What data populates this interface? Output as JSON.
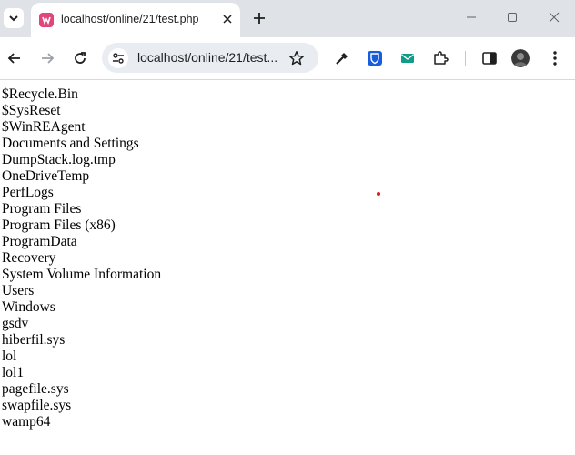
{
  "browser": {
    "tab": {
      "title": "localhost/online/21/test.php"
    },
    "address_bar": {
      "url": "localhost/online/21/test..."
    },
    "colors": {
      "favicon": "#e0457b",
      "bitwarden": "#175ddc",
      "mail_ext": "#0f9d8a"
    }
  },
  "page": {
    "entries": [
      "$Recycle.Bin",
      "$SysReset",
      "$WinREAgent",
      "Documents and Settings",
      "DumpStack.log.tmp",
      "OneDriveTemp",
      "PerfLogs",
      "Program Files",
      "Program Files (x86)",
      "ProgramData",
      "Recovery",
      "System Volume Information",
      "Users",
      "Windows",
      "gsdv",
      "hiberfil.sys",
      "lol",
      "lol1",
      "pagefile.sys",
      "swapfile.sys",
      "wamp64"
    ]
  }
}
